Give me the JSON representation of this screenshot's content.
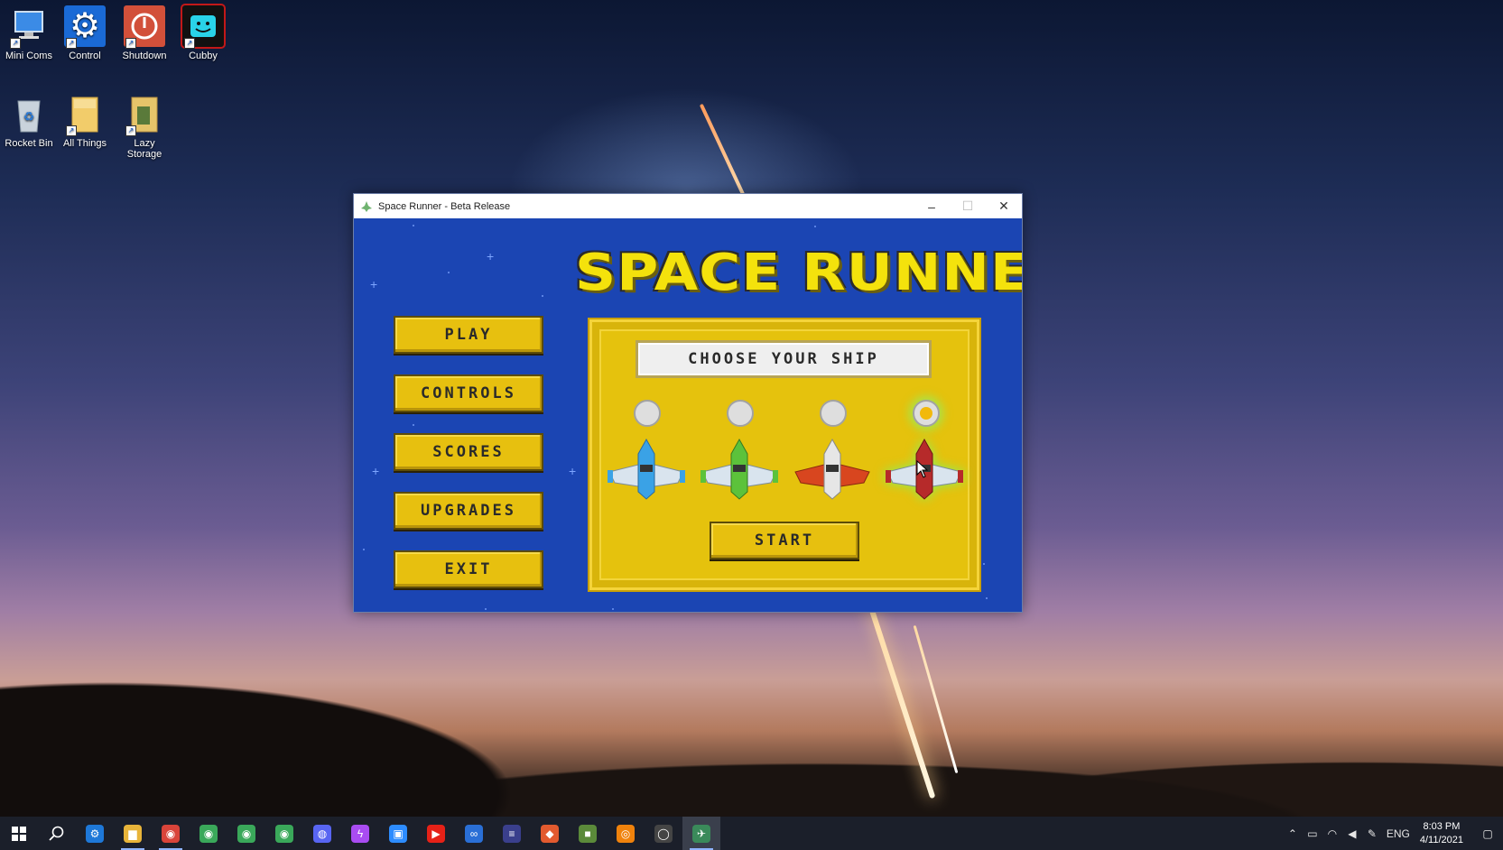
{
  "desktop": {
    "icons": [
      {
        "label": "Mini Coms",
        "icon": "computer-icon"
      },
      {
        "label": "Control",
        "icon": "gear-icon"
      },
      {
        "label": "Shutdown",
        "icon": "power-icon"
      },
      {
        "label": "Cubby",
        "icon": "cubby-app-icon"
      },
      {
        "label": "Rocket Bin",
        "icon": "recycle-bin-icon"
      },
      {
        "label": "All Things",
        "icon": "folder-icon"
      },
      {
        "label": "Lazy Storage",
        "icon": "folder-icon"
      }
    ]
  },
  "window": {
    "title": "Space Runner - Beta Release",
    "minimize": "–",
    "maximize": "☐",
    "close": "✕"
  },
  "game": {
    "logo": "SPACE RUNNER",
    "menu": [
      "PLAY",
      "CONTROLS",
      "SCORES",
      "UPGRADES",
      "EXIT"
    ],
    "panel_title": "CHOOSE YOUR SHIP",
    "ships": [
      {
        "color": "#3aa2e6",
        "selected": false
      },
      {
        "color": "#5cc23b",
        "selected": false
      },
      {
        "color": "#d8461f",
        "selected": false
      },
      {
        "color": "#b62a2a",
        "selected": true
      }
    ],
    "start_label": "START",
    "colors": {
      "background": "#1b45b3",
      "button": "#e7c00f",
      "logo": "#f4e20c"
    }
  },
  "taskbar": {
    "apps": [
      {
        "name": "settings",
        "color": "#1e78d8",
        "glyph": "⚙",
        "active": false
      },
      {
        "name": "file-explorer",
        "color": "#e8b43a",
        "glyph": "▆",
        "active": true
      },
      {
        "name": "chrome",
        "color": "#d9443a",
        "glyph": "◉",
        "active": true
      },
      {
        "name": "chrome",
        "color": "#3aa85a",
        "glyph": "◉",
        "active": false
      },
      {
        "name": "chrome",
        "color": "#3aa85a",
        "glyph": "◉",
        "active": false
      },
      {
        "name": "chrome",
        "color": "#3aa85a",
        "glyph": "◉",
        "active": false
      },
      {
        "name": "discord",
        "color": "#5865f2",
        "glyph": "◍",
        "active": false
      },
      {
        "name": "messenger",
        "color": "#a94cf2",
        "glyph": "ϟ",
        "active": false
      },
      {
        "name": "zoom",
        "color": "#2d8cff",
        "glyph": "▣",
        "active": false
      },
      {
        "name": "youtube-music",
        "color": "#e62117",
        "glyph": "▶",
        "active": false
      },
      {
        "name": "app",
        "color": "#2a6fd6",
        "glyph": "∞",
        "active": false
      },
      {
        "name": "app",
        "color": "#3a3f8c",
        "glyph": "≡",
        "active": false
      },
      {
        "name": "app",
        "color": "#e25a2f",
        "glyph": "◆",
        "active": false
      },
      {
        "name": "minecraft",
        "color": "#5b8a3a",
        "glyph": "■",
        "active": false
      },
      {
        "name": "blender",
        "color": "#f0820c",
        "glyph": "◎",
        "active": false
      },
      {
        "name": "obs",
        "color": "#444444",
        "glyph": "◯",
        "active": false
      },
      {
        "name": "space-runner",
        "color": "#3a8a5a",
        "glyph": "✈",
        "active": true
      }
    ],
    "tray": {
      "language": "ENG",
      "time": "8:03 PM",
      "date": "4/11/2021"
    }
  }
}
